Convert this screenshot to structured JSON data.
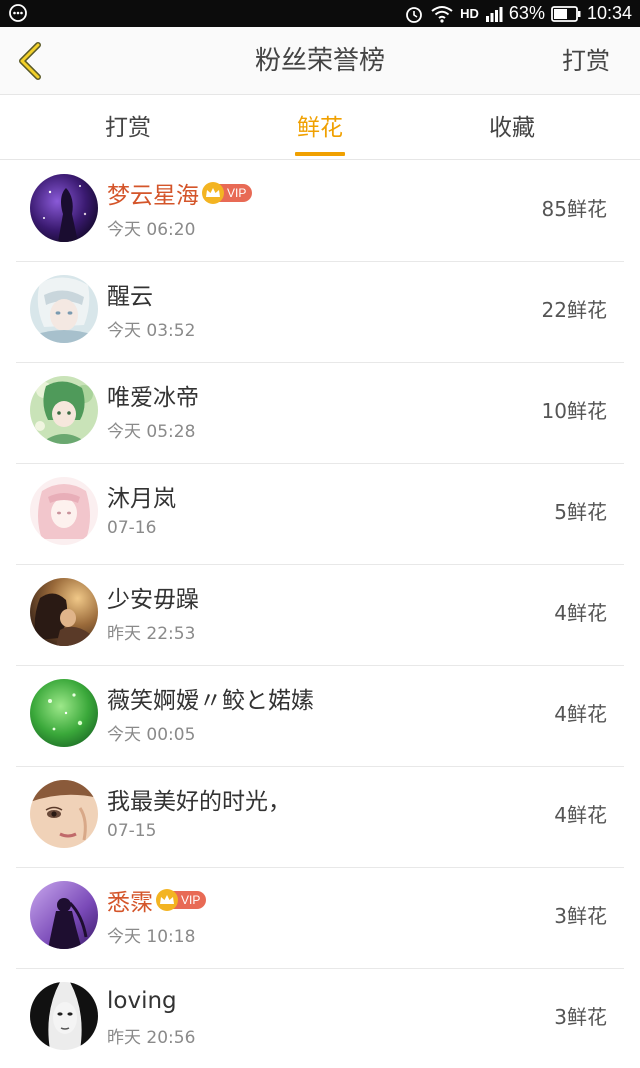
{
  "status_bar": {
    "network": "HD",
    "battery": "63%",
    "time": "10:34",
    "icons": [
      "menu-dots-icon",
      "alarm-icon",
      "wifi-icon",
      "signal-icon",
      "battery-icon"
    ]
  },
  "header": {
    "title": "粉丝荣誉榜",
    "action_label": "打赏",
    "back_icon": "chevron-left-icon",
    "accent_color": "#f0a000"
  },
  "tabs": [
    {
      "label": "打赏",
      "active": false
    },
    {
      "label": "鲜花",
      "active": true
    },
    {
      "label": "收藏",
      "active": false
    }
  ],
  "fans": [
    {
      "name": "梦云星海",
      "vip": true,
      "time": "今天 06:20",
      "count": "85鲜花"
    },
    {
      "name": "醒云",
      "vip": false,
      "time": "今天 03:52",
      "count": "22鲜花"
    },
    {
      "name": "唯爱冰帝",
      "vip": false,
      "time": "今天 05:28",
      "count": "10鲜花"
    },
    {
      "name": "沐月岚",
      "vip": false,
      "time": "07-16",
      "count": "5鲜花"
    },
    {
      "name": "少安毋躁",
      "vip": false,
      "time": "昨天 22:53",
      "count": "4鲜花"
    },
    {
      "name": "薇笑婀嫒〃鲛と婼嫊",
      "vip": false,
      "time": "今天 00:05",
      "count": "4鲜花"
    },
    {
      "name": "我最美好的时光，",
      "vip": false,
      "time": "07-15",
      "count": "4鲜花"
    },
    {
      "name": "悉霂",
      "vip": true,
      "time": "今天 10:18",
      "count": "3鲜花"
    },
    {
      "name": "loving",
      "vip": false,
      "time": "昨天 20:56",
      "count": "3鲜花"
    }
  ],
  "vip_label": "VIP"
}
